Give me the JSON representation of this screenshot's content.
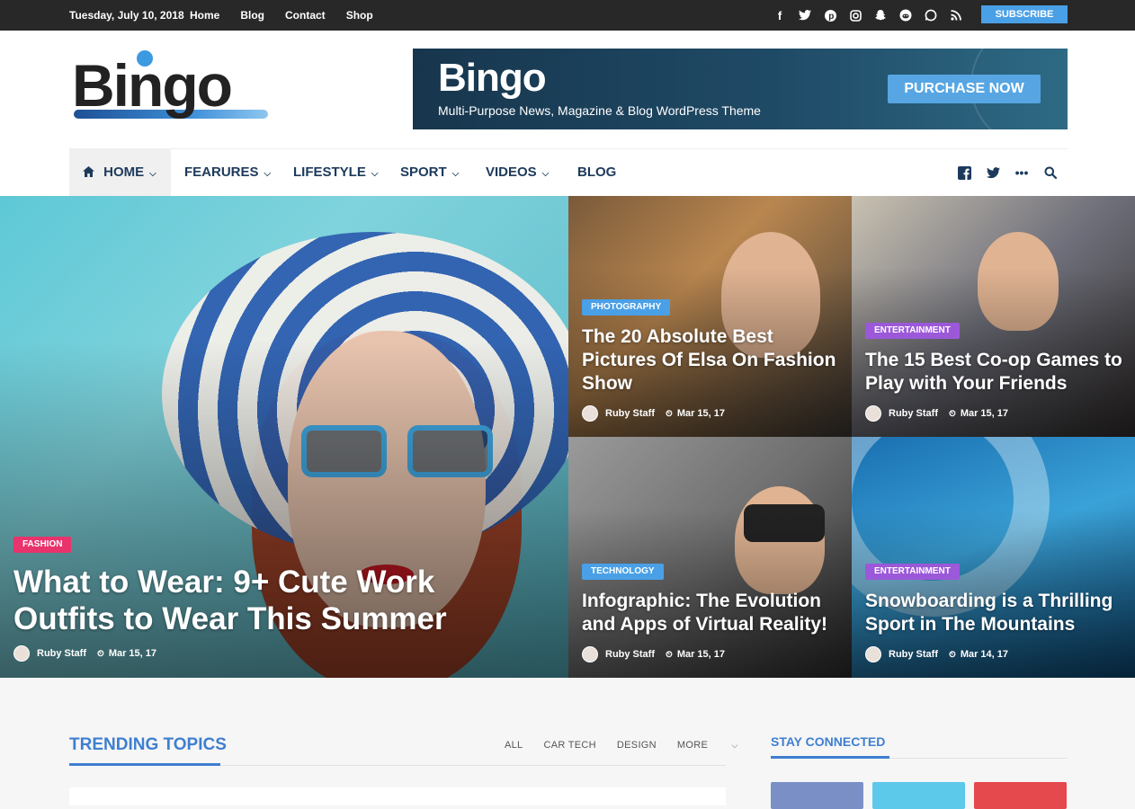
{
  "topbar": {
    "date": "Tuesday, July 10, 2018",
    "links": [
      "Home",
      "Blog",
      "Contact",
      "Shop"
    ],
    "social_icons": [
      "facebook-icon",
      "twitter-icon",
      "pinterest-icon",
      "instagram-icon",
      "snapchat-icon",
      "reddit-icon",
      "whatsapp-icon",
      "rss-icon"
    ],
    "subscribe_label": "SUBSCRIBE"
  },
  "header": {
    "logo_text": "Bingo",
    "banner": {
      "title": "Bingo",
      "subtitle": "Multi-Purpose News, Magazine & Blog WordPress Theme",
      "button": "PURCHASE NOW"
    }
  },
  "nav": {
    "items": [
      {
        "label": "HOME",
        "dropdown": true,
        "icon": "home-icon"
      },
      {
        "label": "FEARURES",
        "dropdown": true
      },
      {
        "label": "LIFESTYLE",
        "dropdown": true
      },
      {
        "label": "SPORT",
        "dropdown": true
      },
      {
        "label": "VIDEOS",
        "dropdown": true
      },
      {
        "label": "BLOG",
        "dropdown": false
      }
    ],
    "right_icons": [
      "facebook-icon",
      "twitter-icon",
      "more-icon",
      "search-icon"
    ]
  },
  "hero": {
    "main": {
      "category": "FASHION",
      "title": "What to Wear: 9+ Cute Work Outfits to Wear This Summer",
      "author": "Ruby Staff",
      "date": "Mar 15, 17"
    },
    "cards": [
      {
        "category": "PHOTOGRAPHY",
        "title": "The 20 Absolute Best Pictures Of Elsa On Fashion Show",
        "author": "Ruby Staff",
        "date": "Mar 15, 17"
      },
      {
        "category": "ENTERTAINMENT",
        "title": "The 15 Best Co-op Games to Play with Your Friends",
        "author": "Ruby Staff",
        "date": "Mar 15, 17"
      },
      {
        "category": "TECHNOLOGY",
        "title": "Infographic: The Evolution and Apps of Virtual Reality!",
        "author": "Ruby Staff",
        "date": "Mar 15, 17"
      },
      {
        "category": "ENTERTAINMENT",
        "title": "Snowboarding is a Thrilling Sport in The Mountains",
        "author": "Ruby Staff",
        "date": "Mar 14, 17"
      }
    ]
  },
  "trending": {
    "heading": "TRENDING TOPICS",
    "tabs": [
      "ALL",
      "CAR TECH",
      "DESIGN",
      "MORE"
    ]
  },
  "sidebar": {
    "heading": "STAY CONNECTED"
  },
  "colors": {
    "accent": "#3f7fd0",
    "fashion": "#e8336d",
    "photography": "#4aa0e6",
    "entertainment": "#9b59d9",
    "technology": "#4aa0e6",
    "topbar": "#282828"
  }
}
